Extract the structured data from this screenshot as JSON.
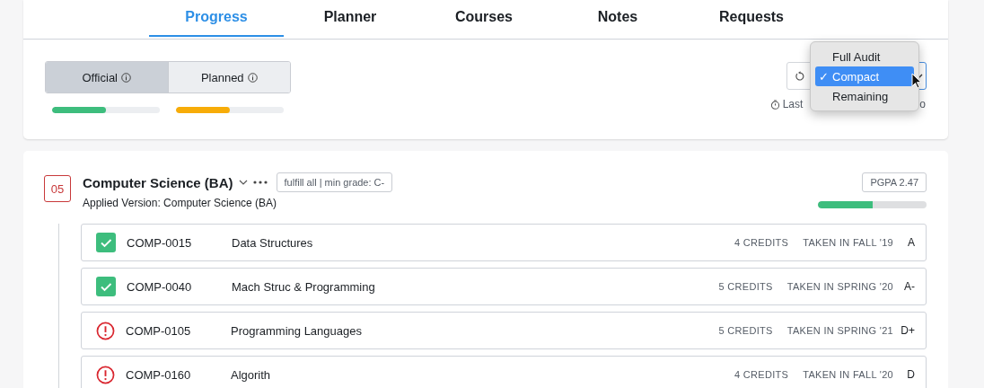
{
  "tabs": [
    {
      "label": "Progress",
      "selected": true
    },
    {
      "label": "Planner",
      "selected": false
    },
    {
      "label": "Courses",
      "selected": false
    },
    {
      "label": "Notes",
      "selected": false
    },
    {
      "label": "Requests",
      "selected": false
    }
  ],
  "toggle": [
    {
      "label": "Official",
      "selected": true,
      "level": 0.5,
      "color": "#3dbd7d"
    },
    {
      "label": "Planned",
      "selected": false,
      "level": 0.5,
      "color": "#f7ac08"
    }
  ],
  "last_updated": {
    "start": "Last",
    "end": "o"
  },
  "view_menu": [
    {
      "label": "Full Audit",
      "selected": false
    },
    {
      "label": "Compact",
      "selected": true,
      "check": "✓"
    },
    {
      "label": "Remaining",
      "selected": false
    }
  ],
  "program": {
    "number": "05",
    "title": "Computer Science (BA)",
    "rule": "fulfill all | min grade: C-",
    "applied_version": "Applied Version: Computer Science (BA)",
    "pgpa": "PGPA 2.47",
    "level": 0.5,
    "courses": [
      {
        "kind": "done",
        "code": "COMP-0015",
        "name": "Data Structures",
        "credits": "4 CREDITS",
        "taken": "TAKEN IN FALL '19",
        "grade": "A"
      },
      {
        "kind": "done",
        "code": "COMP-0040",
        "name": "Mach Struc & Programming",
        "credits": "5 CREDITS",
        "taken": "TAKEN IN SPRING '20",
        "grade": "A-"
      },
      {
        "kind": "warning",
        "code": "COMP-0105",
        "name": "Programming Languages",
        "credits": "5 CREDITS",
        "taken": "TAKEN IN SPRING '21",
        "grade": "D+"
      },
      {
        "kind": "warning",
        "code": "COMP-0160",
        "name": "Algorith",
        "credits": "4 CREDITS",
        "taken": "TAKEN IN FALL '20",
        "grade": "D"
      }
    ]
  }
}
